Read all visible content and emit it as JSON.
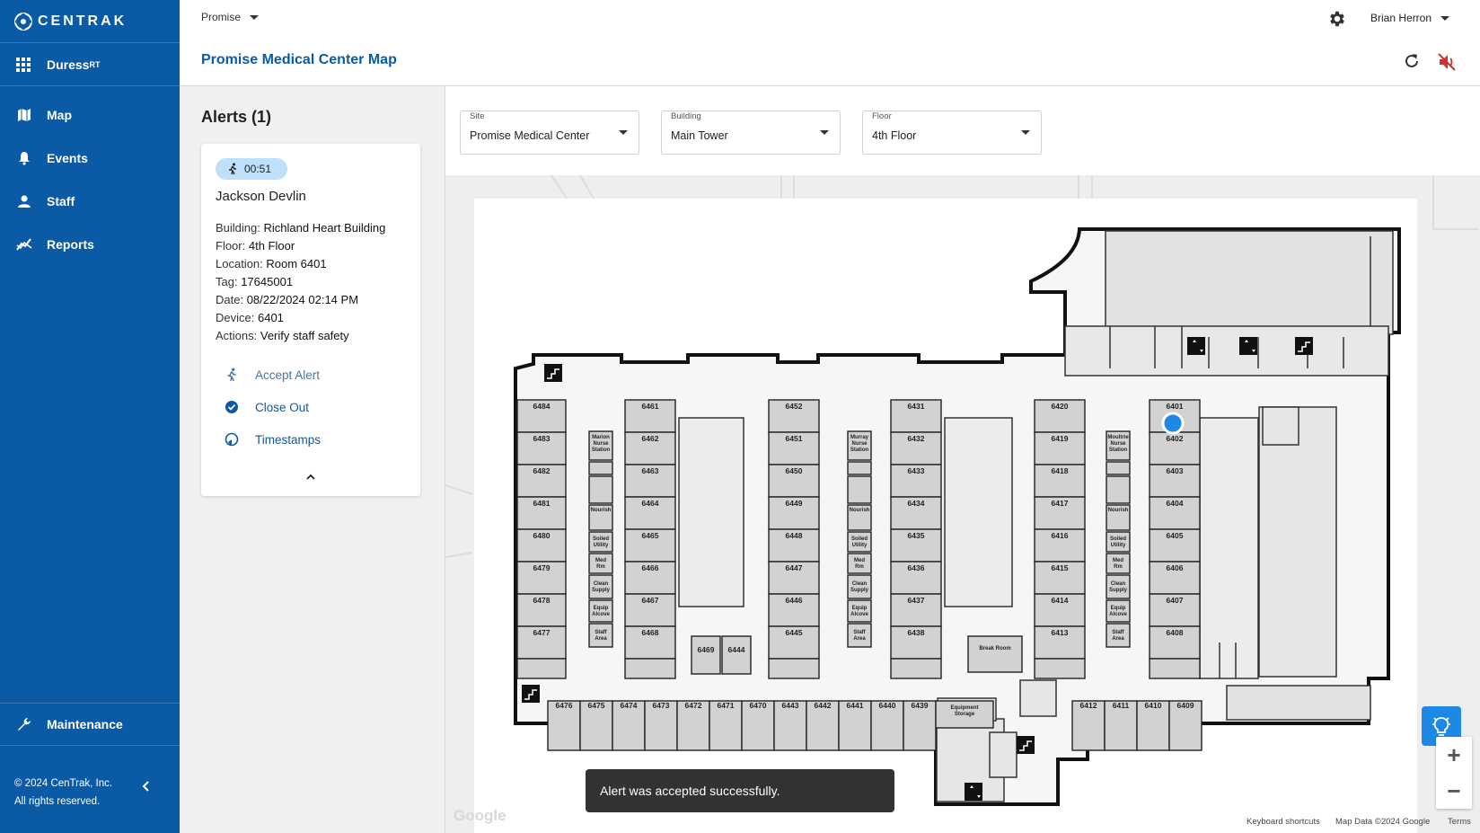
{
  "brand": {
    "name": "CENTRAK"
  },
  "app": {
    "name": "Duress",
    "superscript": "RT"
  },
  "nav": {
    "map": "Map",
    "events": "Events",
    "staff": "Staff",
    "reports": "Reports",
    "maintenance": "Maintenance"
  },
  "footer": {
    "line1": "© 2024 CenTrak, Inc.",
    "line2": "All rights reserved."
  },
  "topbar": {
    "site": "Promise",
    "page_title": "Promise Medical Center Map",
    "user": "Brian Herron"
  },
  "alerts": {
    "title": "Alerts (1)",
    "card": {
      "timer": "00:51",
      "name": "Jackson Devlin",
      "building_label": "Building:",
      "building": "Richland Heart Building",
      "floor_label": "Floor:",
      "floor": "4th Floor",
      "location_label": "Location:",
      "location": "Room 6401",
      "tag_label": "Tag:",
      "tag": "17645001",
      "date_label": "Date:",
      "date": "08/22/2024 02:14 PM",
      "device_label": "Device:",
      "device": "6401",
      "actions_label": "Actions:",
      "actions": "Verify staff safety",
      "accept": "Accept Alert",
      "close_out": "Close Out",
      "timestamps": "Timestamps"
    }
  },
  "filters": {
    "site": {
      "label": "Site",
      "value": "Promise Medical Center"
    },
    "building": {
      "label": "Building",
      "value": "Main Tower"
    },
    "floor": {
      "label": "Floor",
      "value": "4th Floor"
    }
  },
  "map": {
    "rooms_left": [
      "6484",
      "6483",
      "6482",
      "6481",
      "6480",
      "6479",
      "6478",
      "6477"
    ],
    "rooms_c1": [
      "6461",
      "6462",
      "6463",
      "6464",
      "6465",
      "6466",
      "6467",
      "6468"
    ],
    "rooms_c2": [
      "6452",
      "6451",
      "6450",
      "6449",
      "6448",
      "6447",
      "6446",
      "6445"
    ],
    "rooms_c3": [
      "6431",
      "6432",
      "6433",
      "6434",
      "6435",
      "6436",
      "6437",
      "6438"
    ],
    "rooms_c4": [
      "6420",
      "6419",
      "6418",
      "6417",
      "6416",
      "6415",
      "6414",
      "6413"
    ],
    "rooms_c5": [
      "6401",
      "6402",
      "6403",
      "6404",
      "6405",
      "6406",
      "6407",
      "6408"
    ],
    "rooms_bottom_left": [
      "6476",
      "6475",
      "6474",
      "6473",
      "6472",
      "6471",
      "6470",
      "6443",
      "6442",
      "6441",
      "6440",
      "6439"
    ],
    "rooms_bottom_right": [
      "6412",
      "6411",
      "6410",
      "6409"
    ],
    "rooms_misc": {
      "r6469": "6469",
      "r6444": "6444",
      "break_room": "Break Room",
      "equipment_storage_1": "Equipment",
      "equipment_storage_2": "Storage"
    },
    "service_labels": {
      "nourish": "Nourish",
      "soiled_1": "Soiled",
      "soiled_2": "Utility",
      "med_1": "Med",
      "med_2": "Rm",
      "clean_1": "Clean",
      "clean_2": "Supply",
      "equip_1": "Equip",
      "equip_2": "Alcove",
      "staff_1": "Staff",
      "staff_2": "Area",
      "marion_1": "Marion",
      "marion_2": "Nurse",
      "marion_3": "Station",
      "murray_1": "Murray",
      "murray_2": "Nurse",
      "murray_3": "Station",
      "moultrie_1": "Moultrie",
      "moultrie_2": "Nurse",
      "moultrie_3": "Station"
    },
    "google": "Google",
    "footer_shortcuts": "Keyboard shortcuts",
    "footer_data": "Map Data ©2024 Google",
    "footer_terms": "Terms",
    "zoom_in": "+",
    "zoom_out": "−"
  },
  "toast": {
    "message": "Alert was accepted successfully."
  },
  "colors": {
    "sidebar": "#0b5aa6",
    "accent": "#1e88e5",
    "badge": "#bfe0fa",
    "marker": "#1e88e5",
    "mute": "#d32f2f"
  }
}
